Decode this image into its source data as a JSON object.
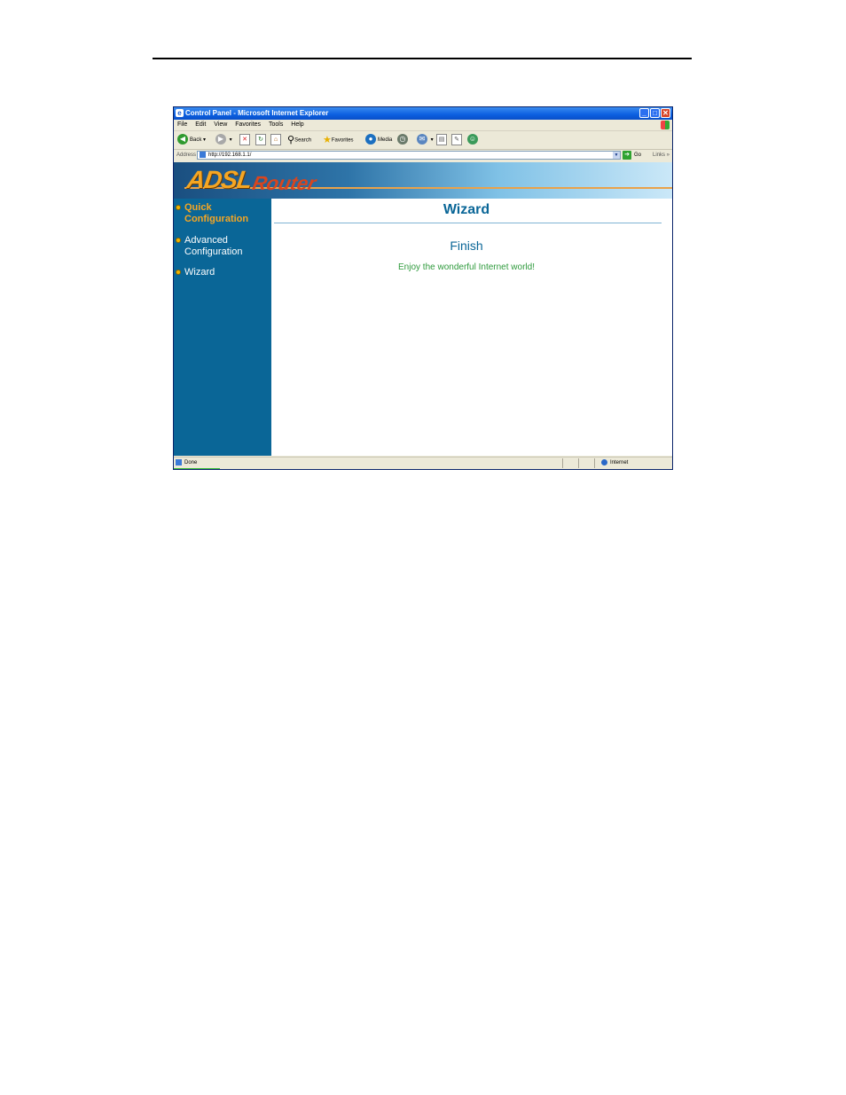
{
  "window": {
    "title": "Control Panel - Microsoft Internet Explorer",
    "minimize_label": "_",
    "maximize_label": "□",
    "close_label": "✕"
  },
  "menu": [
    "File",
    "Edit",
    "View",
    "Favorites",
    "Tools",
    "Help"
  ],
  "toolbar": {
    "back_label": "Back",
    "search_label": "Search",
    "favorites_label": "Favorites",
    "media_label": "Media"
  },
  "address": {
    "label": "Address",
    "url": "http://192.168.1.1/",
    "go_label": "Go",
    "links_label": "Links"
  },
  "banner": {
    "logo_main": "ADSL",
    "logo_sub": "Router"
  },
  "sidebar": {
    "items": [
      {
        "label": "Quick Configuration",
        "color": "#f5a623"
      },
      {
        "label": "Advanced Configuration",
        "color": "#ffffff"
      },
      {
        "label": "Wizard",
        "color": "#ffffff"
      }
    ]
  },
  "content": {
    "title": "Wizard",
    "heading": "Finish",
    "message": "Enjoy the wonderful Internet world!"
  },
  "status": {
    "text": "Done",
    "zone": "Internet"
  },
  "colors": {
    "sidebar_bg": "#0a6697",
    "accent": "#0a6697",
    "message_green": "#2e9a3c"
  }
}
